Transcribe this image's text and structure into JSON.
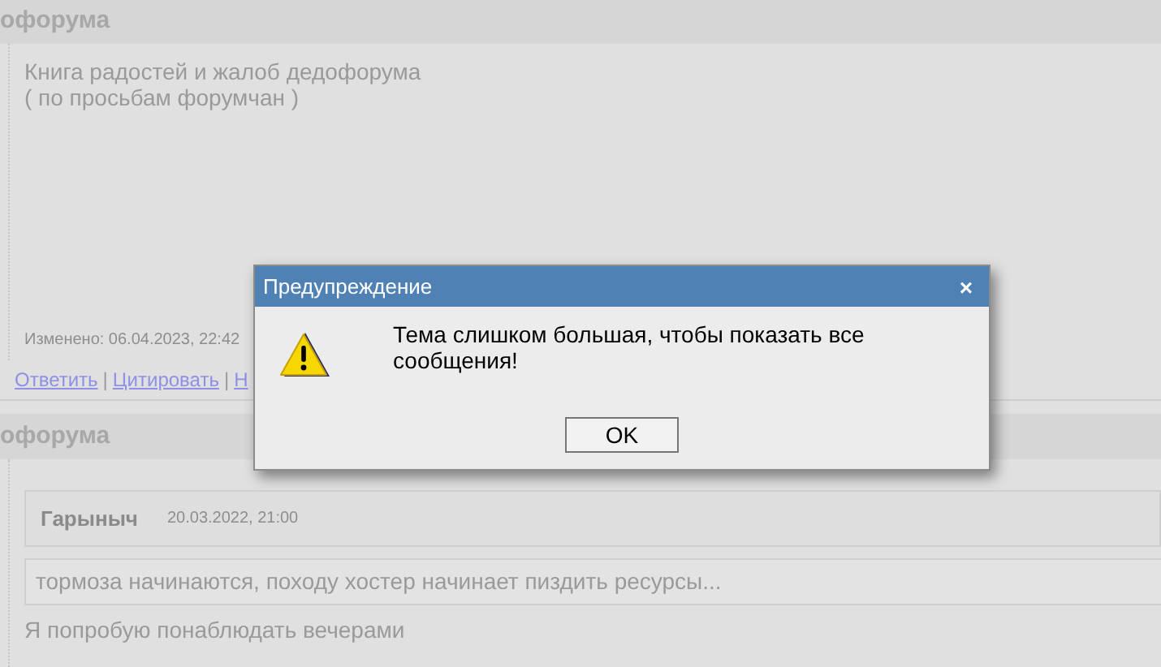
{
  "sections": [
    {
      "title": "офорума",
      "post": {
        "lines": [
          "Книга радостей и жалоб дедофорума",
          "( по просьбам форумчан )"
        ],
        "edited": "Изменено: 06.04.2023, 22:42",
        "links": [
          {
            "label": "Ответить",
            "separator": "|"
          },
          {
            "label": "Цитировать",
            "separator": "|"
          },
          {
            "label": "Н"
          }
        ]
      }
    },
    {
      "title": "офорума",
      "post": {
        "author": "Гарыныч",
        "date": "20.03.2022, 21:00",
        "quote": "тормоза начинаются, походу хостер начинает пиздить ресурсы...",
        "text": "Я попробую понаблюдать вечерами"
      }
    }
  ],
  "dialog": {
    "title": "Предупреждение",
    "close": "×",
    "message": "Тема слишком большая, чтобы показать все сообщения!",
    "button": "OK"
  }
}
